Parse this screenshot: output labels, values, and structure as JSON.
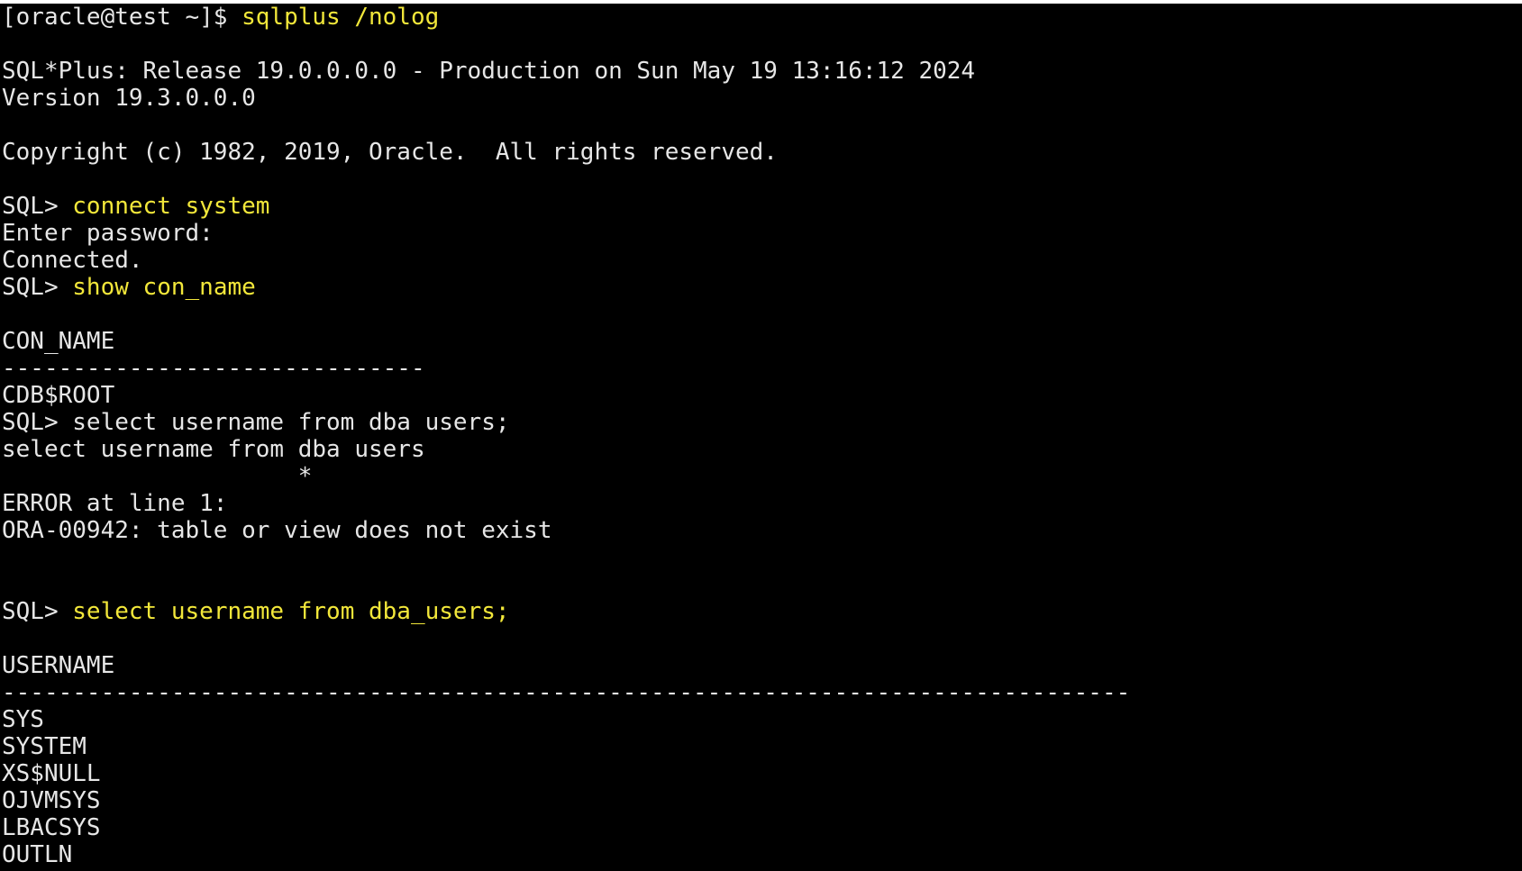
{
  "terminal": {
    "lines": [
      {
        "type": "prompt",
        "prompt": "[oracle@test ~]$ ",
        "cmd": "sqlplus /nolog"
      },
      {
        "type": "blank"
      },
      {
        "type": "text",
        "text": "SQL*Plus: Release 19.0.0.0.0 - Production on Sun May 19 13:16:12 2024"
      },
      {
        "type": "text",
        "text": "Version 19.3.0.0.0"
      },
      {
        "type": "blank"
      },
      {
        "type": "text",
        "text": "Copyright (c) 1982, 2019, Oracle.  All rights reserved."
      },
      {
        "type": "blank"
      },
      {
        "type": "prompt",
        "prompt": "SQL> ",
        "cmd": "connect system"
      },
      {
        "type": "text",
        "text": "Enter password:"
      },
      {
        "type": "text",
        "text": "Connected."
      },
      {
        "type": "prompt",
        "prompt": "SQL> ",
        "cmd": "show con_name"
      },
      {
        "type": "blank"
      },
      {
        "type": "text",
        "text": "CON_NAME"
      },
      {
        "type": "text",
        "text": "------------------------------"
      },
      {
        "type": "text",
        "text": "CDB$ROOT"
      },
      {
        "type": "text",
        "text": "SQL> select username from dba users;"
      },
      {
        "type": "text",
        "text": "select username from dba users"
      },
      {
        "type": "text",
        "text": "                     *"
      },
      {
        "type": "text",
        "text": "ERROR at line 1:"
      },
      {
        "type": "text",
        "text": "ORA-00942: table or view does not exist"
      },
      {
        "type": "blank"
      },
      {
        "type": "blank"
      },
      {
        "type": "prompt",
        "prompt": "SQL> ",
        "cmd": "select username from dba_users;"
      },
      {
        "type": "blank"
      },
      {
        "type": "text",
        "text": "USERNAME"
      },
      {
        "type": "text",
        "text": "--------------------------------------------------------------------------------"
      },
      {
        "type": "text",
        "text": "SYS"
      },
      {
        "type": "text",
        "text": "SYSTEM"
      },
      {
        "type": "text",
        "text": "XS$NULL"
      },
      {
        "type": "text",
        "text": "OJVMSYS"
      },
      {
        "type": "text",
        "text": "LBACSYS"
      },
      {
        "type": "text",
        "text": "OUTLN"
      }
    ]
  },
  "colors": {
    "background": "#000000",
    "output_text": "#e6e6e6",
    "command_text": "#f2e73a"
  }
}
